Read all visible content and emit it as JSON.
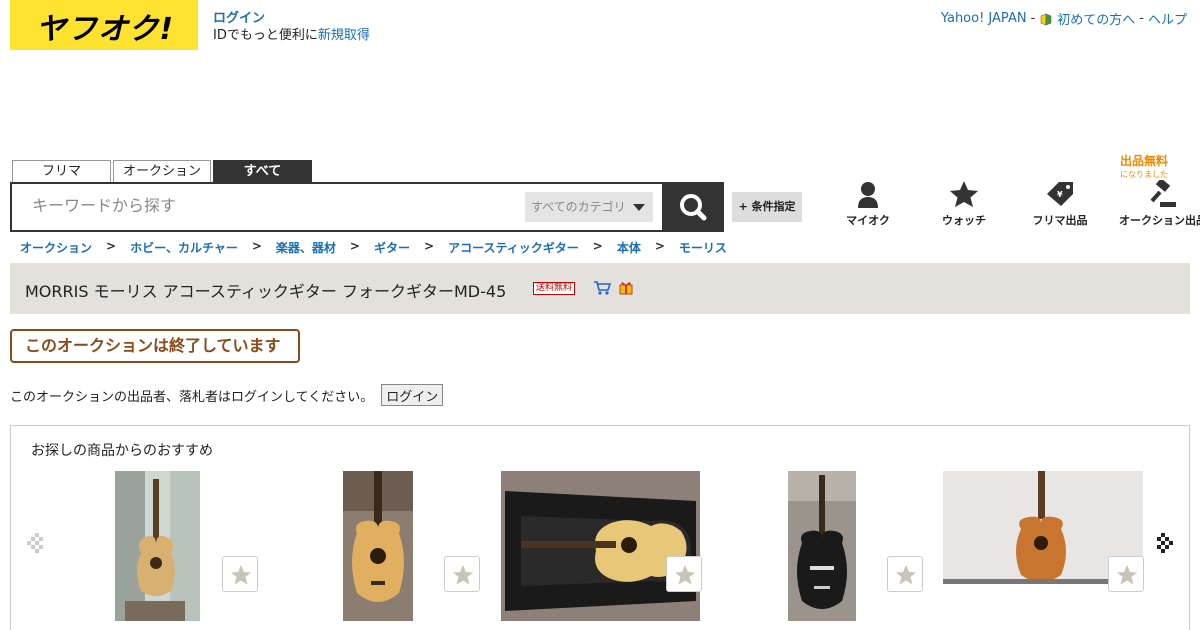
{
  "header": {
    "logo_text": "ヤフオク!",
    "login_label": "ログイン",
    "id_prompt": "IDでもっと便利に",
    "signup_label": "新規取得",
    "links": [
      "Yahoo! JAPAN",
      "初めての方へ",
      "ヘルプ"
    ],
    "separator": "-"
  },
  "search": {
    "tabs": [
      "フリマ",
      "オークション",
      "すべて"
    ],
    "active_tab": "すべて",
    "placeholder": "キーワードから探す",
    "category": "すべてのカテゴリ",
    "condition_label": "+ 条件指定"
  },
  "nav": {
    "items": [
      "マイオク",
      "ウォッチ",
      "フリマ出品",
      "オークション出品"
    ],
    "free_badge_main": "出品無料",
    "free_badge_sub": "になりました"
  },
  "breadcrumb": [
    "オークション",
    "ホビー、カルチャー",
    "楽器、器材",
    "ギター",
    "アコースティックギター",
    "本体",
    "モーリス"
  ],
  "breadcrumb_sep": ">",
  "item": {
    "title": "MORRIS モーリス アコースティックギター フォークギターMD-45",
    "shipping_badge": "送料無料"
  },
  "status": {
    "ended_notice": "このオークションは終了しています",
    "login_message": "このオークションの出品者、落札者はログインしてください。",
    "login_button": "ログイン"
  },
  "recommend": {
    "title": "お探しの商品からのおすすめ"
  },
  "colors": {
    "brand_yellow": "#ffe330",
    "link_blue": "#1a6fb4",
    "dark": "#333333",
    "ended_brown": "#8a4b1a",
    "free_orange": "#f08a00"
  }
}
